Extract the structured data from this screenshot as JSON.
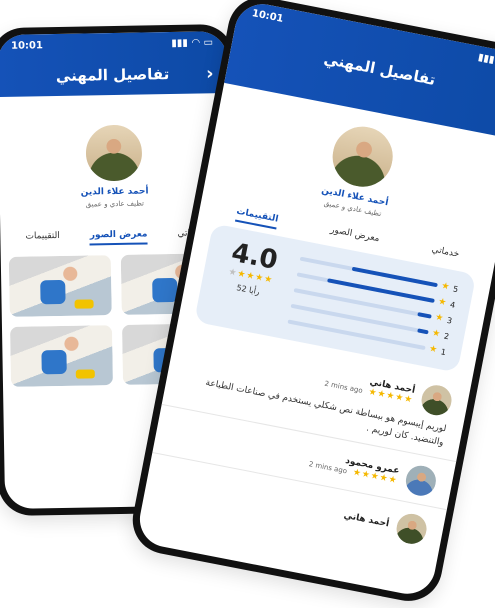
{
  "status": {
    "time": "10:01"
  },
  "header": {
    "title": "تفاصيل المهني",
    "back_icon": "chevron-right-icon"
  },
  "profile": {
    "name": "أحمد علاء الدين",
    "subtitle": "تظيف عادي و عميق"
  },
  "back_screen": {
    "tabs": [
      {
        "label": "خدماتي"
      },
      {
        "label": "معرض الصور",
        "active": true
      },
      {
        "label": "التقييمات"
      }
    ],
    "gallery": [
      {
        "label": "cleaning-photo-1"
      },
      {
        "label": "cleaning-photo-2"
      },
      {
        "label": "cleaning-photo-3"
      },
      {
        "label": "cleaning-photo-4"
      }
    ]
  },
  "front_screen": {
    "tabs": [
      {
        "label": "التقييمات",
        "active": true
      },
      {
        "label": "معرض الصور"
      },
      {
        "label": "خدماتي"
      }
    ],
    "rating": {
      "score": "4.0",
      "count_text": "52 رأيا",
      "stars_filled": 4,
      "stars_total": 5,
      "distribution": [
        {
          "stars": "5",
          "fraction": 0.62
        },
        {
          "stars": "4",
          "fraction": 0.78
        },
        {
          "stars": "3",
          "fraction": 0.1
        },
        {
          "stars": "2",
          "fraction": 0.08
        },
        {
          "stars": "1",
          "fraction": 0.0
        }
      ]
    },
    "reviews": [
      {
        "name": "أحمد هاني",
        "time": "2 mins ago",
        "stars": "★★★★★",
        "text": "لوريم إيبسوم هو ببساطة نص شكلي يستخدم في صناعات الطباعة والتنضيد. كان لوريم ."
      },
      {
        "name": "عمرو محمود",
        "time": "2 mins ago",
        "stars": "★★★★★",
        "text": ""
      },
      {
        "name": "أحمد هاني",
        "time": "",
        "stars": "",
        "text": ""
      }
    ]
  },
  "colors": {
    "primary": "#1552b8",
    "star": "#f5b800",
    "card_bg": "#e6eef8"
  }
}
